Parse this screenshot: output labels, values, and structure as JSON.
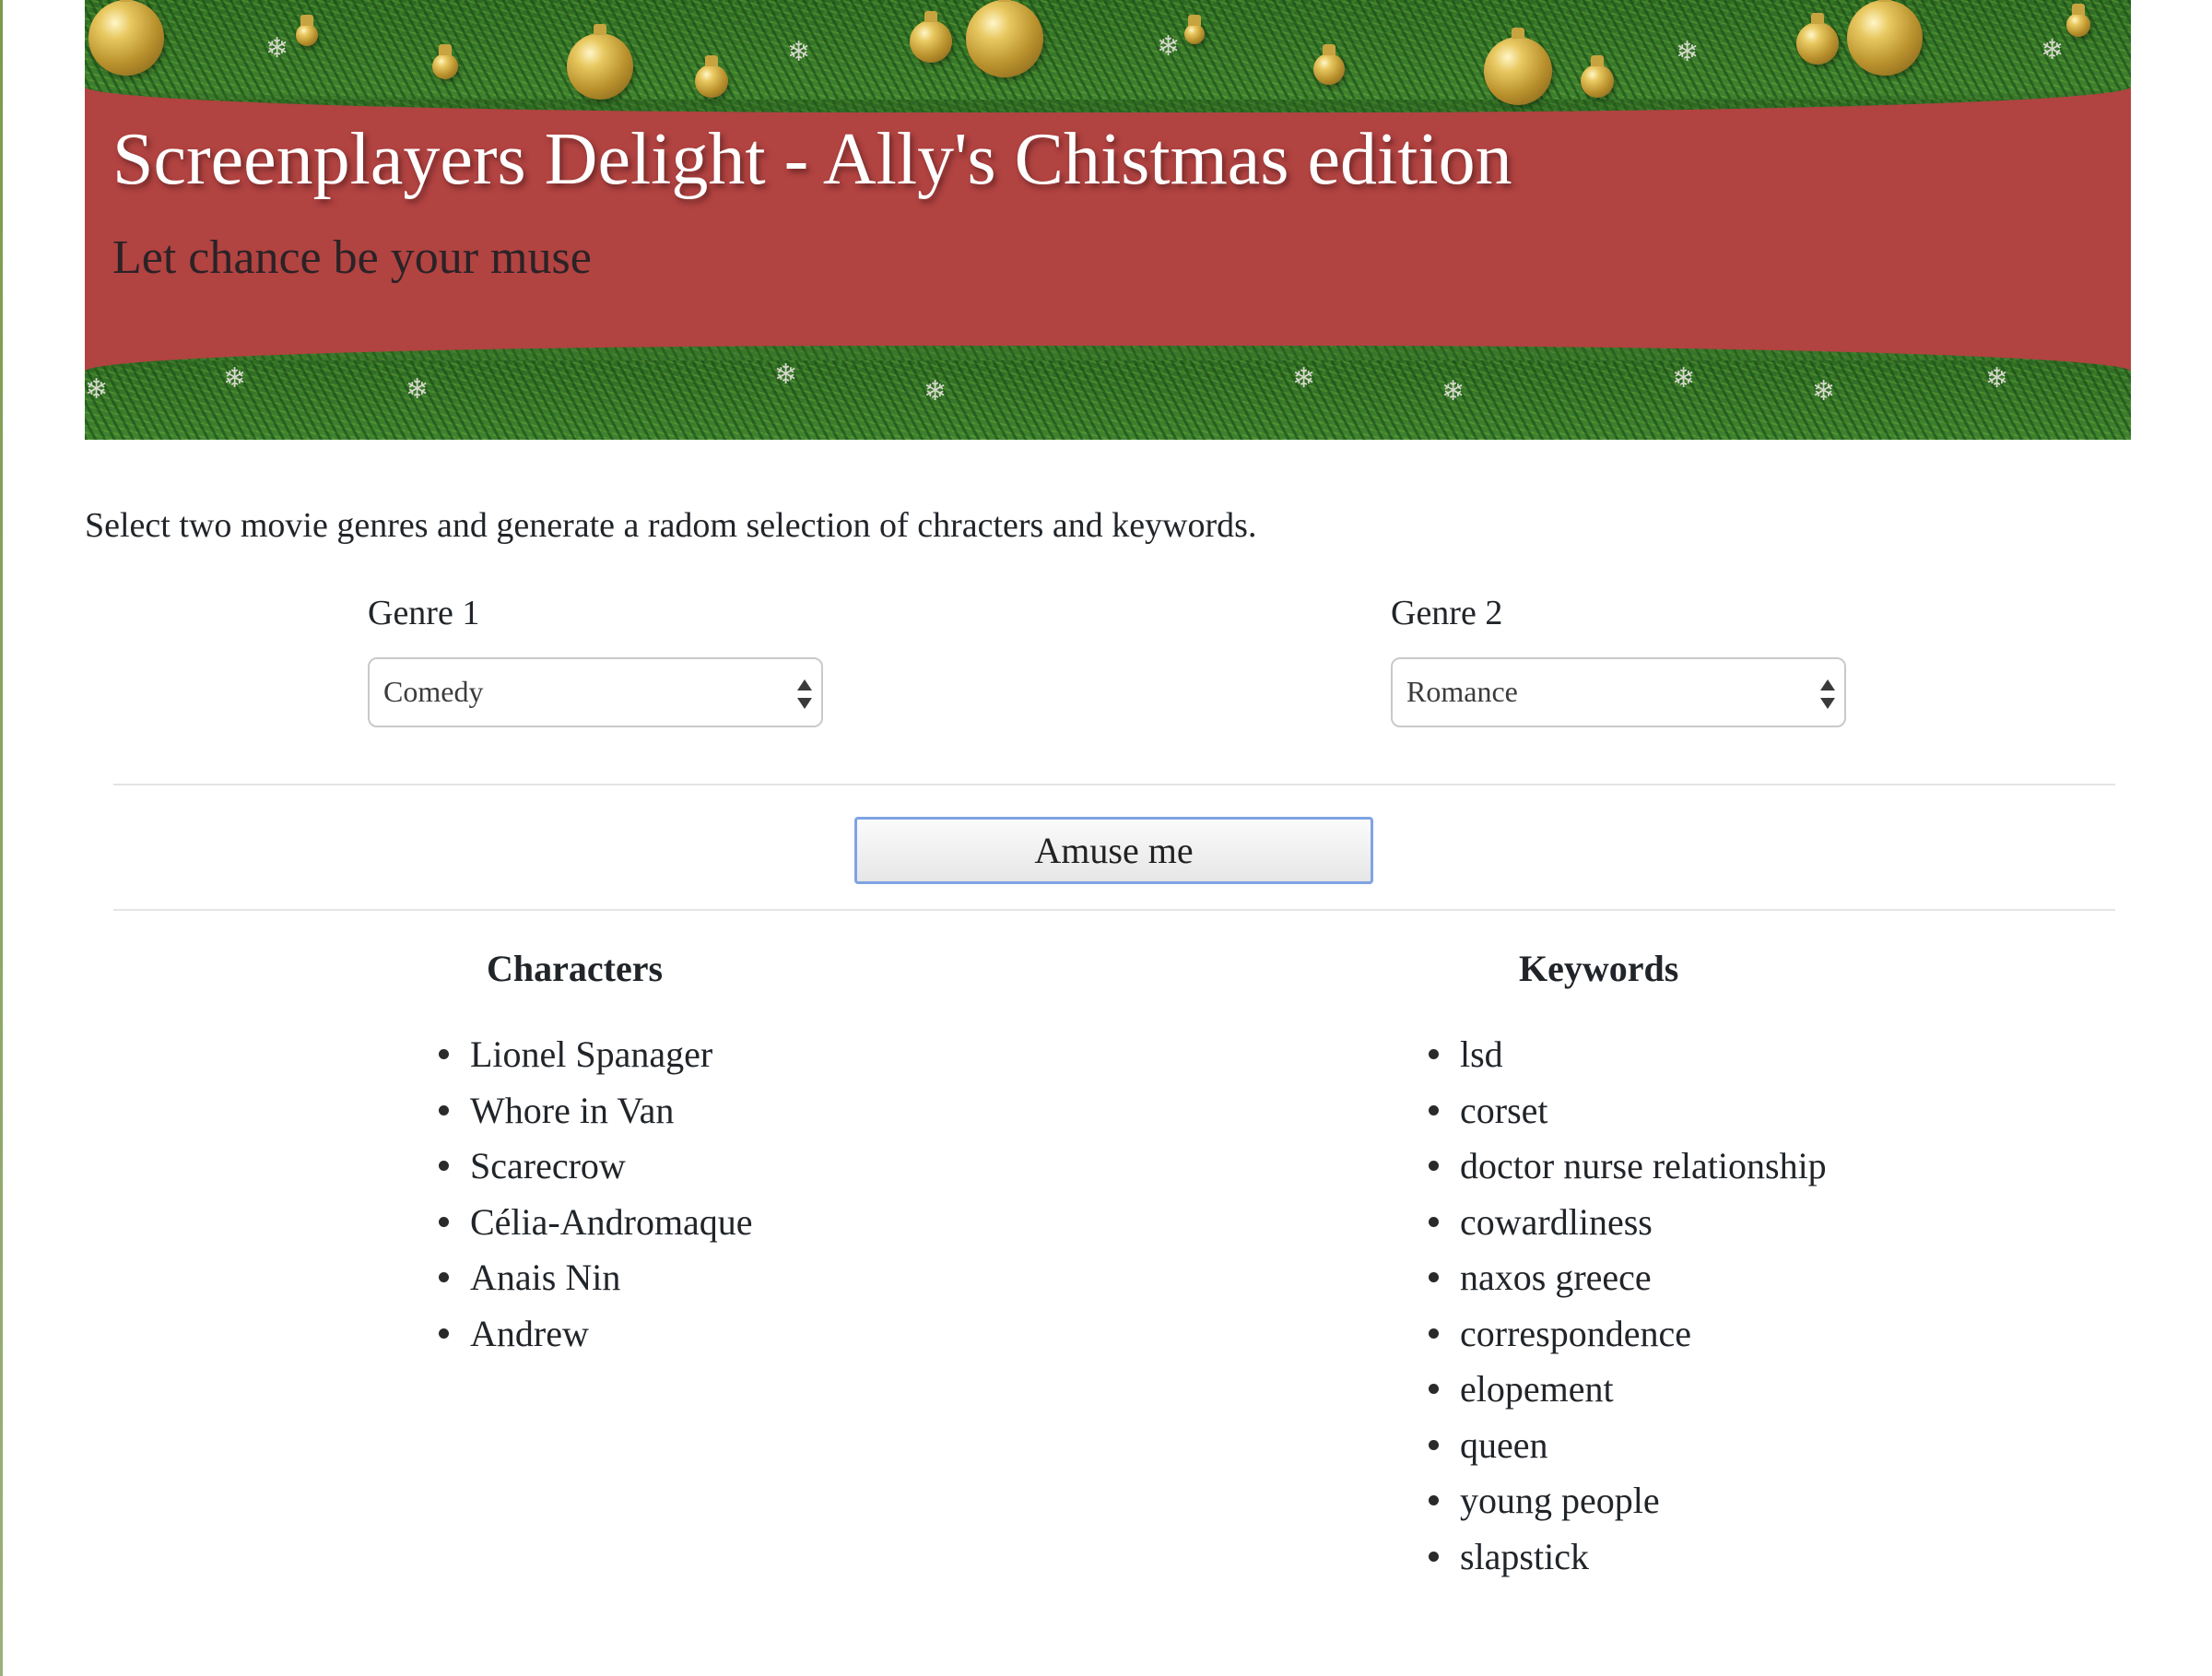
{
  "header": {
    "title": "Screenplayers Delight - Ally's Chistmas edition",
    "subtitle": "Let chance be your muse"
  },
  "intro": "Select two movie genres and generate a radom selection of chracters and keywords.",
  "genre1": {
    "label": "Genre 1",
    "selected": "Comedy"
  },
  "genre2": {
    "label": "Genre 2",
    "selected": "Romance"
  },
  "action": {
    "label": "Amuse me"
  },
  "characters": {
    "heading": "Characters",
    "items": [
      "Lionel Spanager",
      "Whore in Van",
      "Scarecrow",
      "Célia-Andromaque",
      "Anais Nin",
      "Andrew"
    ]
  },
  "keywords": {
    "heading": "Keywords",
    "items": [
      "lsd",
      "corset",
      "doctor nurse relationship",
      "cowardliness",
      "naxos greece",
      "correspondence",
      "elopement",
      "queen",
      "young people",
      "slapstick"
    ]
  },
  "colors": {
    "banner_red": "#b14341",
    "garland_green": "#3f8330",
    "ornament_gold": "#c8a440",
    "button_focus_border": "#7fa4e4"
  },
  "icons": [
    "ornament-icon",
    "snowflake-icon",
    "select-arrows-icon",
    "bullet-icon"
  ]
}
